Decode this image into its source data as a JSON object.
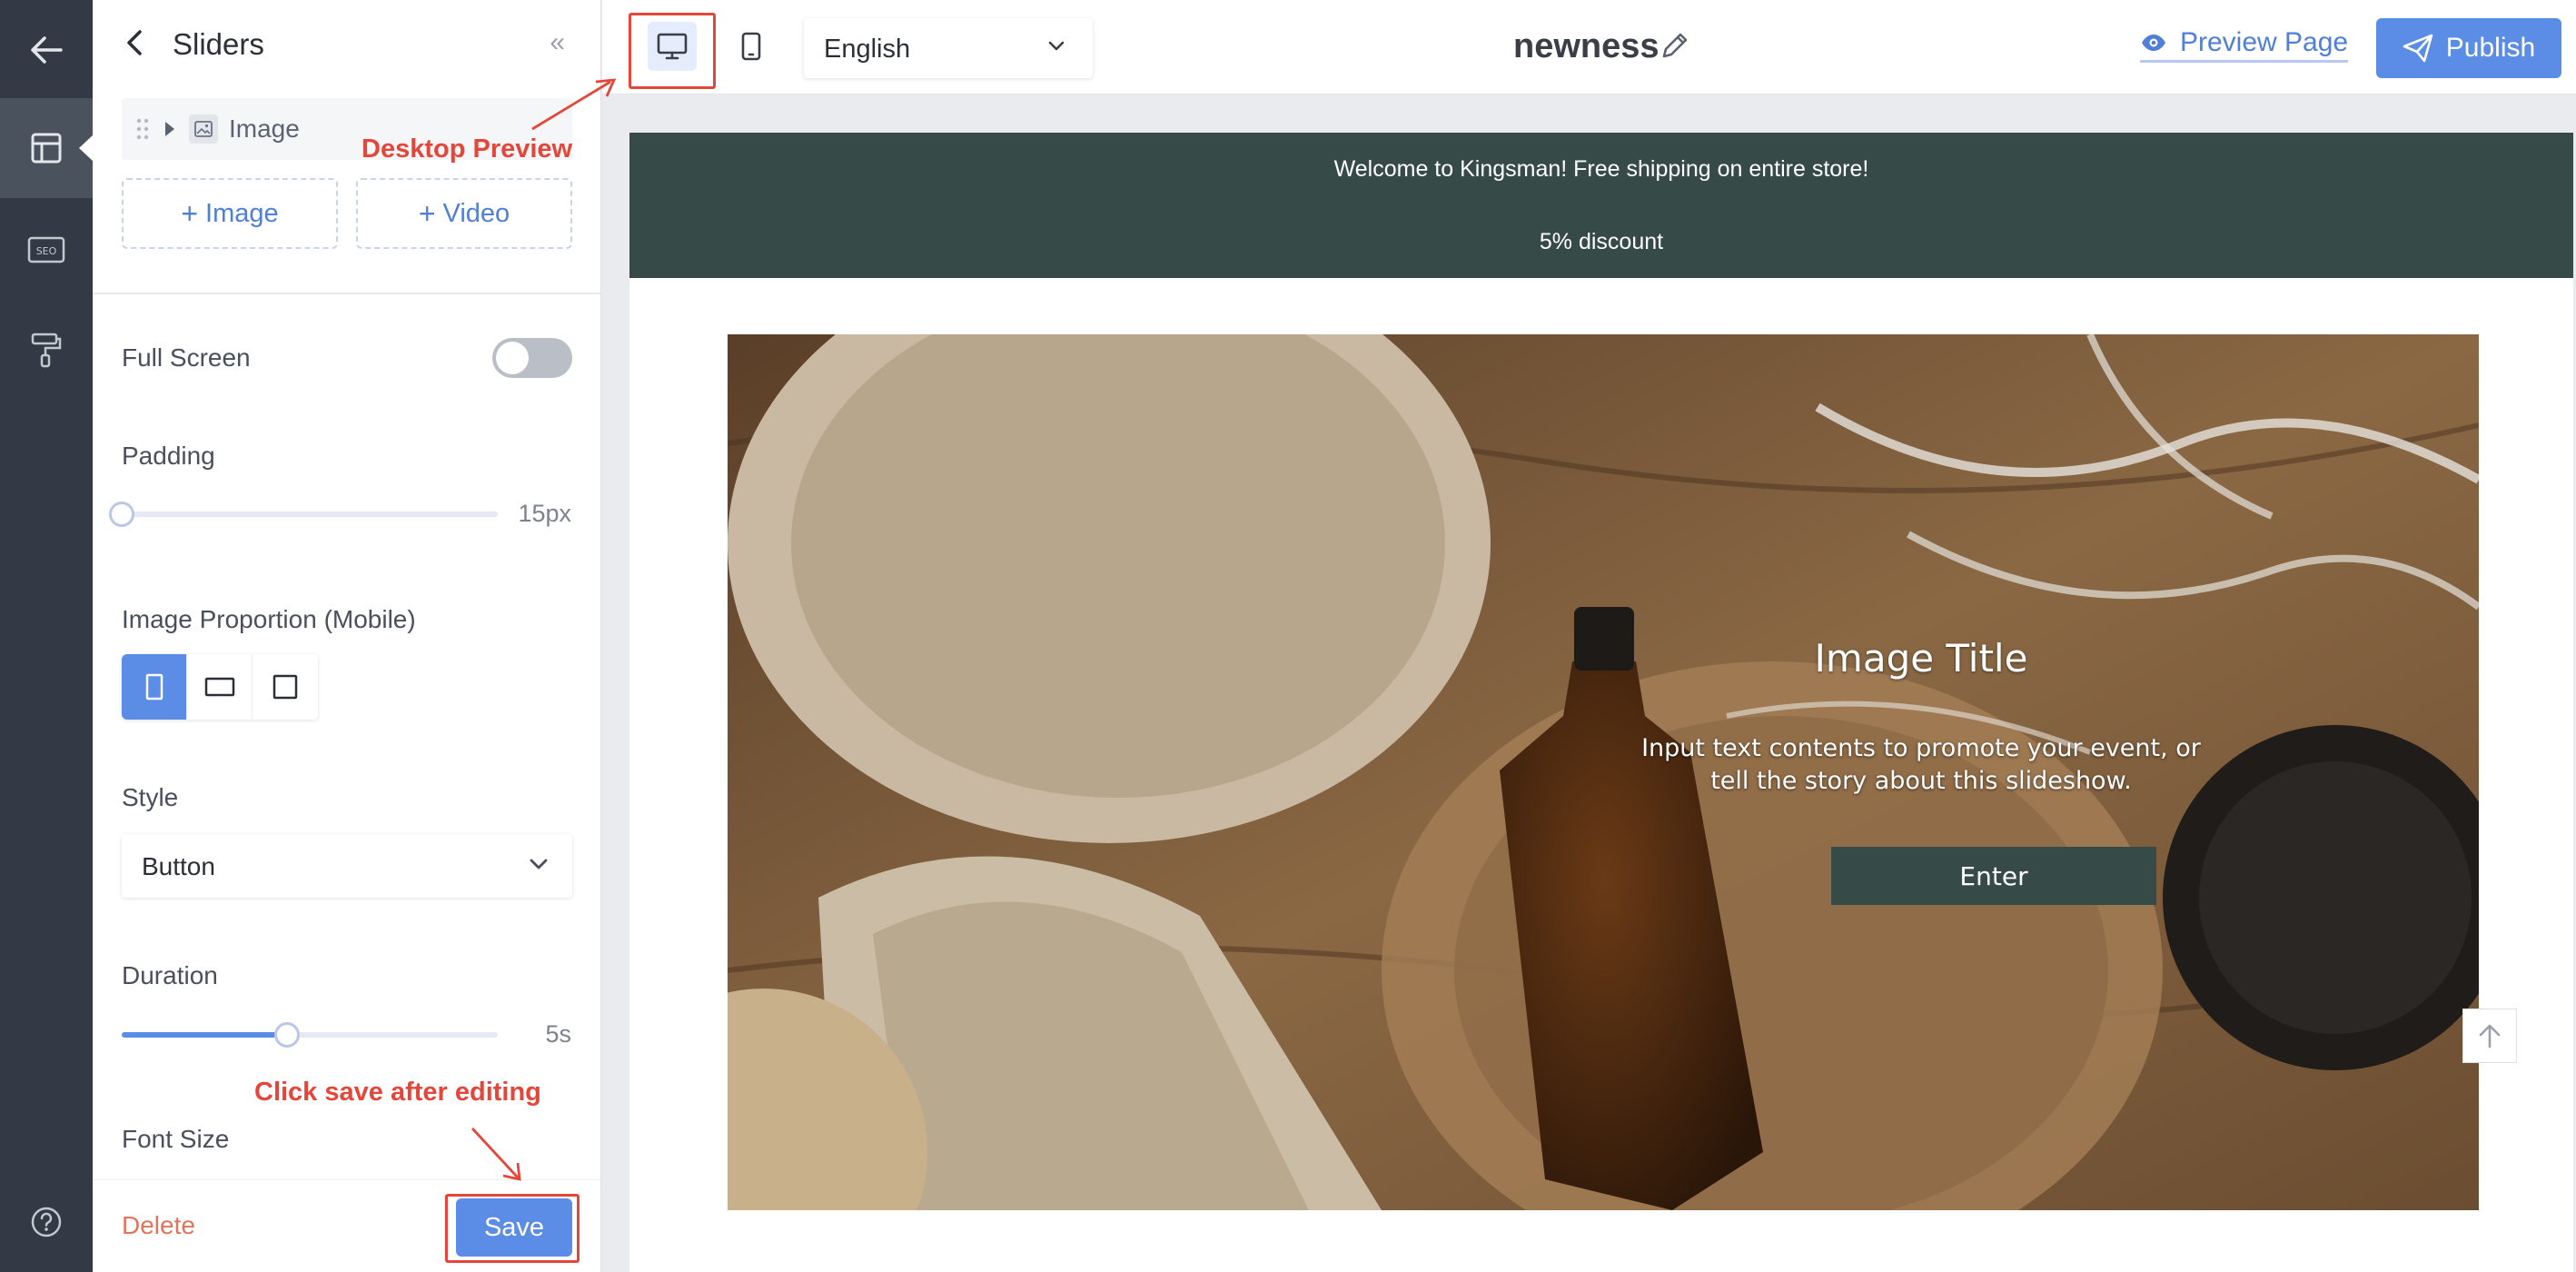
{
  "panel": {
    "title": "Sliders",
    "collapse_glyph": "«",
    "tree_item_label": "Image",
    "add_image_label": "Image",
    "add_video_label": "Video",
    "full_screen_label": "Full Screen",
    "full_screen_on": false,
    "padding_label": "Padding",
    "padding_value": "15px",
    "padding_level": 0.0,
    "image_proportion_label": "Image Proportion (Mobile)",
    "image_proportion_selected": "portrait",
    "style_label": "Style",
    "style_value": "Button",
    "duration_label": "Duration",
    "duration_value": "5s",
    "duration_level": 0.44,
    "font_size_label": "Font Size",
    "delete_label": "Delete",
    "save_label": "Save"
  },
  "annotations": {
    "desktop_preview": "Desktop Preview",
    "click_save": "Click save after editing",
    "color": "#e4473a"
  },
  "topbar": {
    "language": "English",
    "page_name": "newness",
    "preview_label": "Preview Page",
    "publish_label": "Publish",
    "active_device": "desktop"
  },
  "canvas": {
    "announcement_line1": "Welcome to Kingsman! Free shipping on entire store!",
    "announcement_line2": "5% discount",
    "hero_title": "Image Title",
    "hero_text": "Input text contents to promote your event, or tell the story about this slideshow.",
    "hero_button": "Enter"
  },
  "icons": {
    "rail": [
      "arrow-left-icon",
      "layout-icon",
      "seo-icon",
      "paint-roller-icon",
      "help-icon"
    ],
    "topbar": [
      "desktop-icon",
      "mobile-icon",
      "chevron-down-icon",
      "pencil-icon",
      "eye-icon",
      "paper-plane-icon"
    ]
  },
  "colors": {
    "accent": "#5b8ce6",
    "rail_bg": "#333a45",
    "announcement_bg": "#364a47",
    "delete_text": "#e0745c"
  }
}
